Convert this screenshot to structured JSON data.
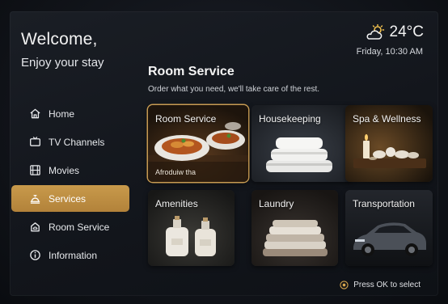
{
  "welcome": {
    "title": "Welcome,",
    "subtitle": "Enjoy your stay"
  },
  "weather": {
    "icon": "partly-cloudy-icon",
    "temperature": "24°C",
    "datetime": "Friday, 10:30 AM"
  },
  "nav": {
    "items": [
      {
        "label": "Home",
        "icon": "home-icon"
      },
      {
        "label": "TV Channels",
        "icon": "tv-icon"
      },
      {
        "label": "Movies",
        "icon": "film-icon"
      },
      {
        "label": "Services",
        "icon": "concierge-bell-icon",
        "active": true
      },
      {
        "label": "Room Service",
        "icon": "room-service-icon"
      },
      {
        "label": "Information",
        "icon": "info-icon"
      }
    ]
  },
  "section": {
    "title": "Room Service",
    "subtitle": "Order what you need, we'll take care of the rest."
  },
  "tiles": [
    {
      "label": "Room Service",
      "caption": "Afroduiw tha",
      "selected": true
    },
    {
      "label": "Housekeeping"
    },
    {
      "label": "Spa & Wellness"
    },
    {
      "label": "Amenities"
    },
    {
      "label": "Laundry"
    },
    {
      "label": "Transportation"
    }
  ],
  "footer": {
    "hint": "Press OK to select"
  },
  "colors": {
    "accent": "#c89a4b",
    "background": "#12151b"
  }
}
